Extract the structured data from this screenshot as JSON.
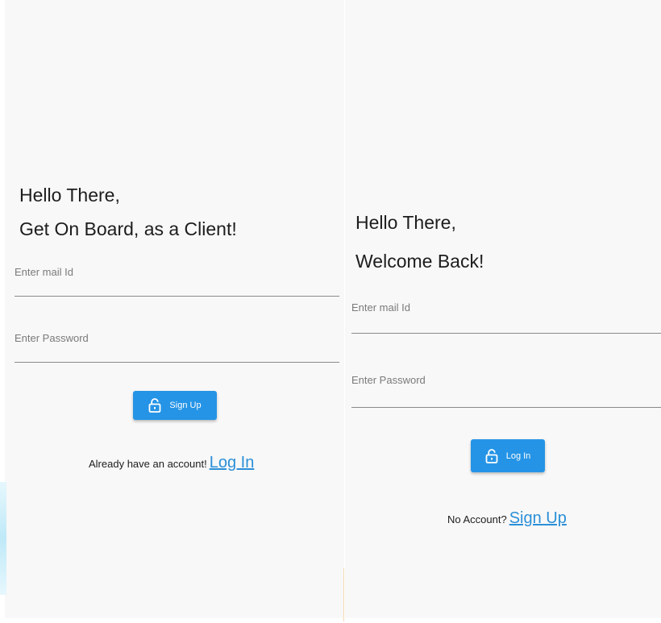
{
  "signup": {
    "greeting": "Hello There,",
    "subtitle": "Get On Board, as a Client!",
    "email_placeholder": "Enter mail Id",
    "password_placeholder": "Enter Password",
    "button_label": "Sign Up",
    "footer_text": "Already have an account!",
    "footer_link": "Log In"
  },
  "login": {
    "greeting": "Hello There,",
    "subtitle": "Welcome Back!",
    "email_placeholder": "Enter mail Id",
    "password_placeholder": "Enter Password",
    "button_label": "Log In",
    "footer_text": "No Account?",
    "footer_link": "Sign Up"
  },
  "colors": {
    "primary_button": "#2594e6",
    "link": "#2b8fd8",
    "background": "#f8f8f8",
    "underline": "#8a8a8a"
  },
  "icons": {
    "button_icon": "lock-open-icon"
  }
}
